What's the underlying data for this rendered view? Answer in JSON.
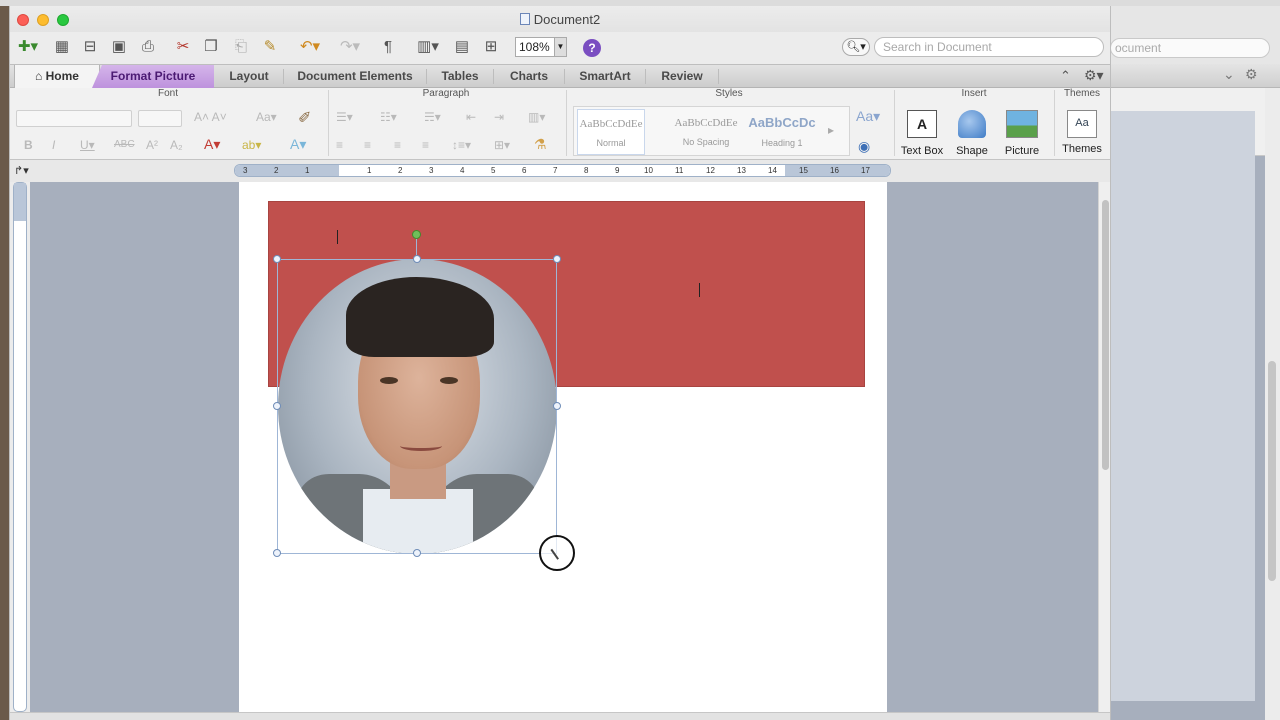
{
  "window": {
    "title": "Document2"
  },
  "toolbar": {
    "zoom_value": "108%",
    "help_label": "?",
    "search_placeholder": "Search in Document"
  },
  "tabs": [
    {
      "label": "Home"
    },
    {
      "label": "Format Picture"
    },
    {
      "label": "Layout"
    },
    {
      "label": "Document Elements"
    },
    {
      "label": "Tables"
    },
    {
      "label": "Charts"
    },
    {
      "label": "SmartArt"
    },
    {
      "label": "Review"
    }
  ],
  "ribbon": {
    "groups": {
      "font": "Font",
      "paragraph": "Paragraph",
      "styles": "Styles",
      "insert": "Insert",
      "themes": "Themes"
    },
    "styles": [
      {
        "sample": "AaBbCcDdEe",
        "name": "Normal"
      },
      {
        "sample": "AaBbCcDdEe",
        "name": "No Spacing"
      },
      {
        "sample": "AaBbCcDc",
        "name": "Heading 1"
      }
    ],
    "insert_buttons": [
      {
        "label": "Text Box"
      },
      {
        "label": "Shape"
      },
      {
        "label": "Picture"
      }
    ],
    "themes_button": "Themes"
  },
  "ruler": {
    "numbers": [
      "3",
      "2",
      "1",
      "1",
      "2",
      "3",
      "4",
      "5",
      "6",
      "7",
      "8",
      "9",
      "10",
      "11",
      "12",
      "13",
      "14",
      "15",
      "16",
      "17"
    ]
  },
  "background_window": {
    "search_fragment": "ocument"
  },
  "colors": {
    "header_box": "#c0504d",
    "format_tab": "#be92dd",
    "canvas": "#a7afbd"
  }
}
